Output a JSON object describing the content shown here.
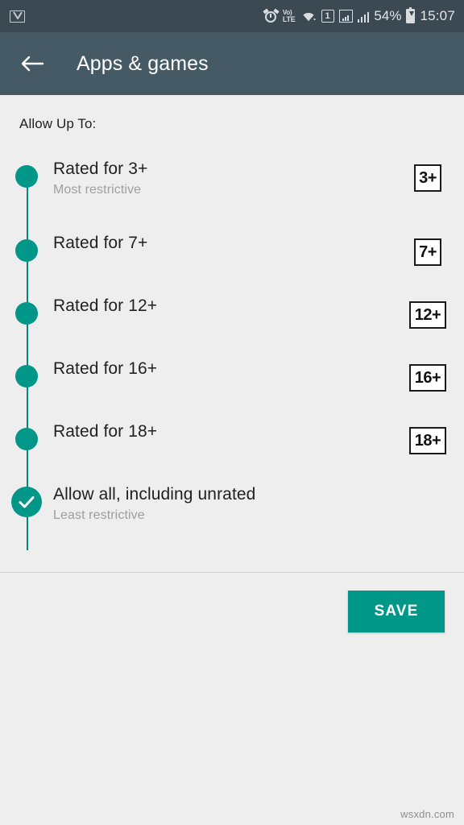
{
  "status_bar": {
    "notification_icon": "gmail-icon",
    "icons": [
      "alarm-icon",
      "volte-icon",
      "wifi-icon",
      "sim1-icon",
      "signal-boxed-icon",
      "signal-icon"
    ],
    "volte_top": "Vo)",
    "volte_bottom": "LTE",
    "sim_label": "1",
    "battery_percent": "54%",
    "time": "15:07"
  },
  "app_bar": {
    "back_icon": "arrow-left-icon",
    "title": "Apps & games",
    "background": "#455a64"
  },
  "content": {
    "section_label": "Allow Up To:",
    "accent_color": "#009688",
    "items": [
      {
        "title": "Rated for 3+",
        "subtitle": "Most restrictive",
        "badge": "3+",
        "badge_wide": false,
        "selected": false
      },
      {
        "title": "Rated for 7+",
        "subtitle": "",
        "badge": "7+",
        "badge_wide": false,
        "selected": false
      },
      {
        "title": "Rated for 12+",
        "subtitle": "",
        "badge": "12+",
        "badge_wide": true,
        "selected": false
      },
      {
        "title": "Rated for 16+",
        "subtitle": "",
        "badge": "16+",
        "badge_wide": true,
        "selected": false
      },
      {
        "title": "Rated for 18+",
        "subtitle": "",
        "badge": "18+",
        "badge_wide": true,
        "selected": false
      },
      {
        "title": "Allow all, including unrated",
        "subtitle": "Least restrictive",
        "badge": "",
        "badge_wide": false,
        "selected": true
      }
    ]
  },
  "footer": {
    "save_label": "SAVE",
    "save_color": "#009688"
  },
  "watermark": "wsxdn.com"
}
